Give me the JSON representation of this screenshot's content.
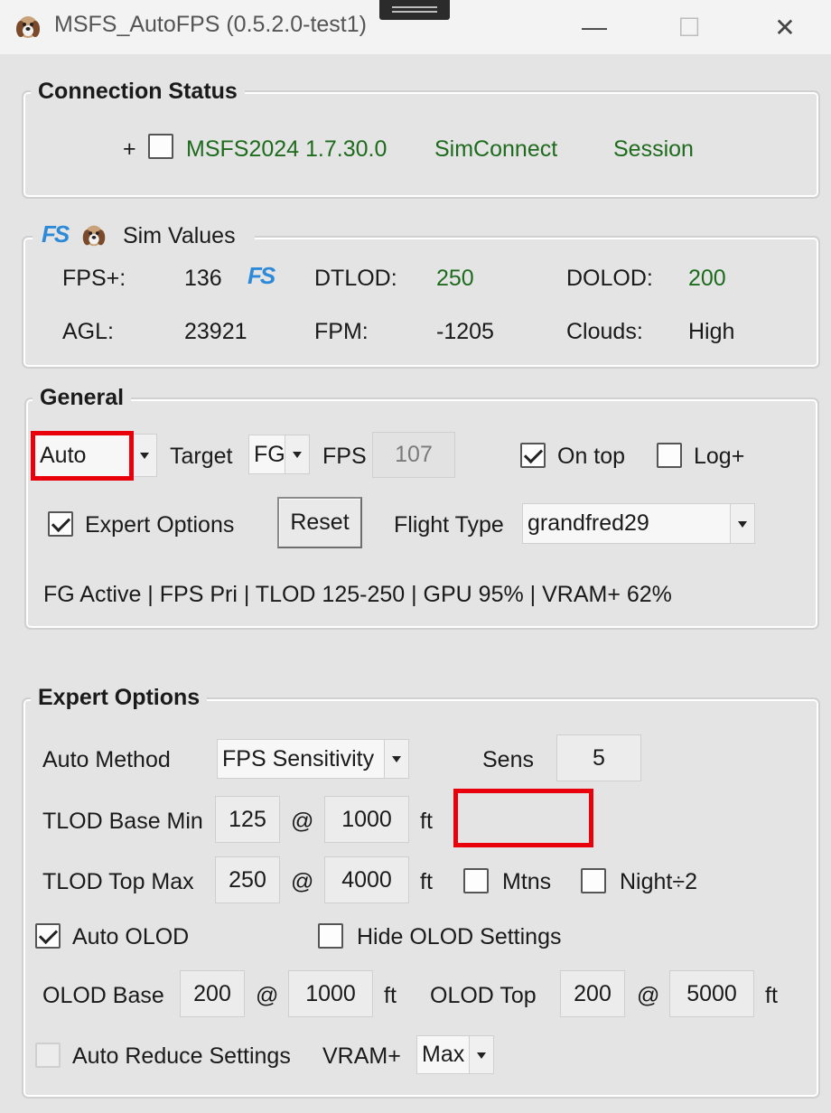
{
  "window": {
    "title": "MSFS_AutoFPS (0.5.2.0-test1)",
    "minimize_glyph": "—",
    "maximize_glyph": "☐",
    "close_glyph": "✕",
    "app_icon": "dog-icon"
  },
  "connection": {
    "title": "Connection Status",
    "plus": "+",
    "sim_label": "MSFS2024 1.7.30.0",
    "simconnect_label": "SimConnect",
    "session_label": "Session",
    "status_color": "#1e6b1e"
  },
  "sim_values": {
    "title": "Sim Values",
    "fps_logo": "FS",
    "fps_label": "FPS+:",
    "fps_value": "136",
    "dtlod_label": "DTLOD:",
    "dtlod_value": "250",
    "dolod_label": "DOLOD:",
    "dolod_value": "200",
    "agl_label": "AGL:",
    "agl_value": "23921",
    "fpm_label": "FPM:",
    "fpm_value": "-1205",
    "clouds_label": "Clouds:",
    "clouds_value": "High"
  },
  "general": {
    "title": "General",
    "mode_value": "Auto",
    "target_label": "Target",
    "target_value": "FG",
    "fps_label": "FPS",
    "fps_value": "107",
    "on_top_label": "On top",
    "on_top_checked": true,
    "log_label": "Log+",
    "log_checked": false,
    "expert_label": "Expert Options",
    "expert_checked": true,
    "reset_label": "Reset",
    "flight_type_label": "Flight Type",
    "flight_type_value": "grandfred29",
    "status_line": "FG Active | FPS Pri | TLOD 125-250 | GPU 95% | VRAM+ 62%"
  },
  "expert": {
    "title": "Expert Options",
    "auto_method_label": "Auto Method",
    "auto_method_value": "FPS Sensitivity",
    "sens_label": "Sens",
    "sens_value": "5",
    "tlod_base_label": "TLOD Base Min",
    "tlod_base_value": "125",
    "tlod_base_at": "@",
    "tlod_base_alt": "1000",
    "tlod_base_unit": "ft",
    "tlod_top_label": "TLOD Top Max",
    "tlod_top_value": "250",
    "tlod_top_at": "@",
    "tlod_top_alt": "4000",
    "tlod_top_unit": "ft",
    "mtns_label": "Mtns",
    "night_label": "Night÷2",
    "auto_olod_label": "Auto OLOD",
    "auto_olod_checked": true,
    "hide_olod_label": "Hide OLOD Settings",
    "olod_base_label": "OLOD Base",
    "olod_base_value": "200",
    "olod_base_at": "@",
    "olod_base_alt": "1000",
    "olod_base_unit": "ft",
    "olod_top_label": "OLOD Top",
    "olod_top_value": "200",
    "olod_top_at": "@",
    "olod_top_alt": "5000",
    "olod_top_unit": "ft",
    "auto_reduce_label": "Auto Reduce Settings",
    "vram_label": "VRAM+",
    "vram_value": "Max"
  },
  "colors": {
    "highlight_red": "#e8000b",
    "fs_logo_blue": "#2c8ad8"
  }
}
